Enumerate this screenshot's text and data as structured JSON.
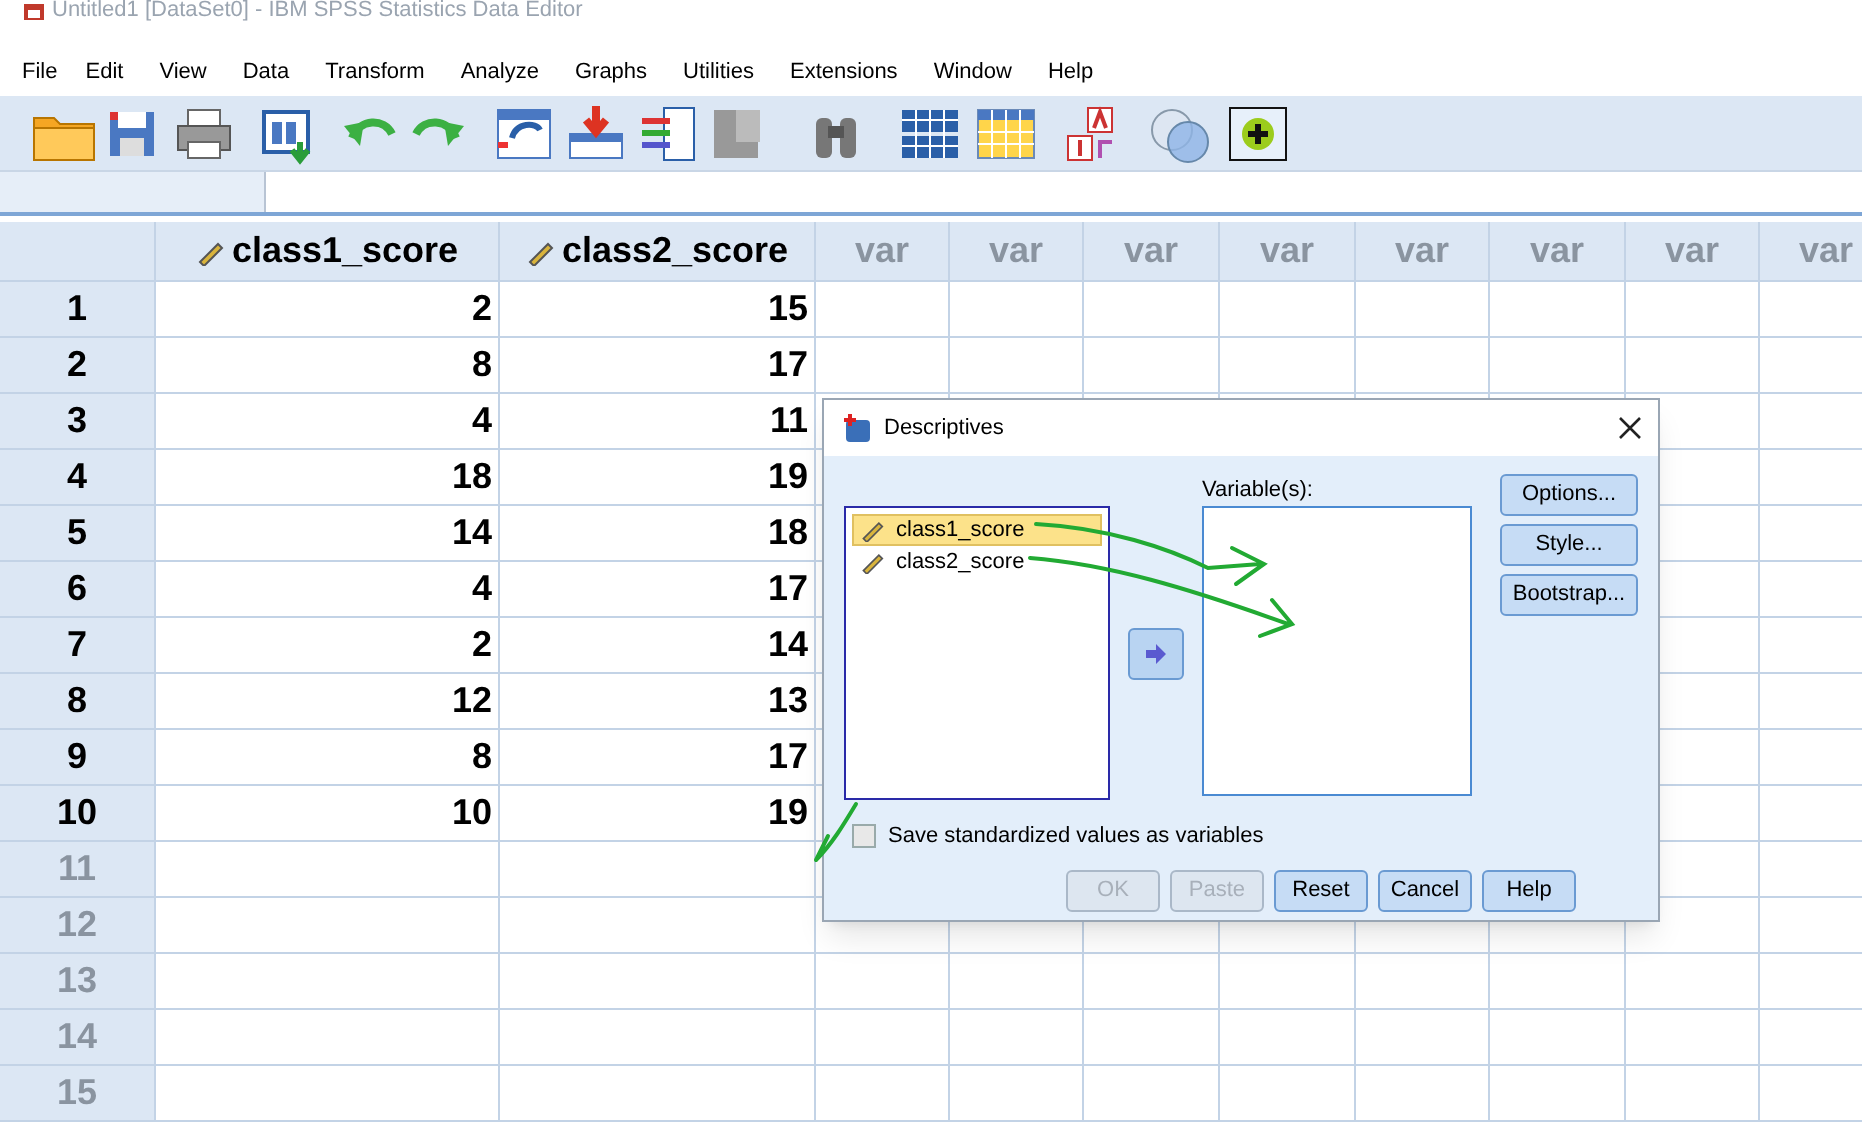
{
  "window": {
    "title": "Untitled1 [DataSet0] - IBM SPSS Statistics Data Editor"
  },
  "menu": [
    "File",
    "Edit",
    "View",
    "Data",
    "Transform",
    "Analyze",
    "Graphs",
    "Utilities",
    "Extensions",
    "Window",
    "Help"
  ],
  "grid": {
    "columns": [
      {
        "label": "class1_score",
        "kind": "variable"
      },
      {
        "label": "class2_score",
        "kind": "variable"
      },
      {
        "label": "var",
        "kind": "empty"
      },
      {
        "label": "var",
        "kind": "empty"
      },
      {
        "label": "var",
        "kind": "empty"
      },
      {
        "label": "var",
        "kind": "empty"
      },
      {
        "label": "var",
        "kind": "empty"
      },
      {
        "label": "var",
        "kind": "empty"
      },
      {
        "label": "var",
        "kind": "empty"
      },
      {
        "label": "var",
        "kind": "empty"
      }
    ],
    "rows": [
      {
        "number": "1",
        "empty": false,
        "cells": [
          "2",
          "15"
        ]
      },
      {
        "number": "2",
        "empty": false,
        "cells": [
          "8",
          "17"
        ]
      },
      {
        "number": "3",
        "empty": false,
        "cells": [
          "4",
          "11"
        ]
      },
      {
        "number": "4",
        "empty": false,
        "cells": [
          "18",
          "19"
        ]
      },
      {
        "number": "5",
        "empty": false,
        "cells": [
          "14",
          "18"
        ]
      },
      {
        "number": "6",
        "empty": false,
        "cells": [
          "4",
          "17"
        ]
      },
      {
        "number": "7",
        "empty": false,
        "cells": [
          "2",
          "14"
        ]
      },
      {
        "number": "8",
        "empty": false,
        "cells": [
          "12",
          "13"
        ]
      },
      {
        "number": "9",
        "empty": false,
        "cells": [
          "8",
          "17"
        ]
      },
      {
        "number": "10",
        "empty": false,
        "cells": [
          "10",
          "19"
        ]
      },
      {
        "number": "11",
        "empty": true,
        "cells": []
      },
      {
        "number": "12",
        "empty": true,
        "cells": []
      },
      {
        "number": "13",
        "empty": true,
        "cells": []
      },
      {
        "number": "14",
        "empty": true,
        "cells": []
      },
      {
        "number": "15",
        "empty": true,
        "cells": []
      }
    ]
  },
  "dialog": {
    "title": "Descriptives",
    "source_list": [
      {
        "label": "class1_score",
        "selected": true
      },
      {
        "label": "class2_score",
        "selected": false
      }
    ],
    "target_label": "Variable(s):",
    "side_buttons": [
      "Options...",
      "Style...",
      "Bootstrap..."
    ],
    "checkbox": {
      "label": "Save standardized values as variables",
      "checked": false
    },
    "buttons": [
      {
        "label": "OK",
        "disabled": true
      },
      {
        "label": "Paste",
        "disabled": true
      },
      {
        "label": "Reset",
        "disabled": false
      },
      {
        "label": "Cancel",
        "disabled": false
      },
      {
        "label": "Help",
        "disabled": false
      }
    ]
  }
}
